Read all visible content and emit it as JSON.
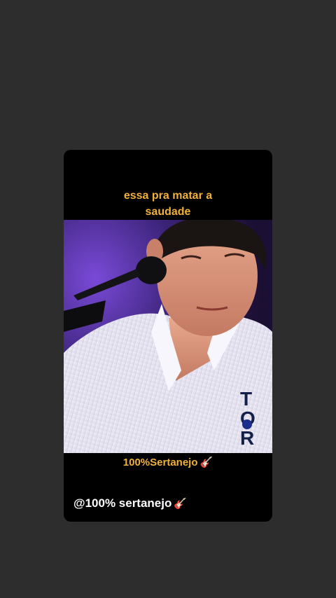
{
  "story": {
    "caption_line1": "essa pra matar a",
    "caption_line2": "saudade",
    "brand_text": "100%Sertanejo",
    "brand_icon": "guitar-icon",
    "handle_text": "@100% sertanejo",
    "handle_icon": "guitar-icon",
    "guitar_glyph": "🎸",
    "shirt_lettering": "TOR"
  },
  "colors": {
    "background": "#2d2d2d",
    "card": "#000000",
    "caption": "#f2b13a",
    "handle": "#ffffff",
    "stage_light": "#5a2fb0"
  }
}
